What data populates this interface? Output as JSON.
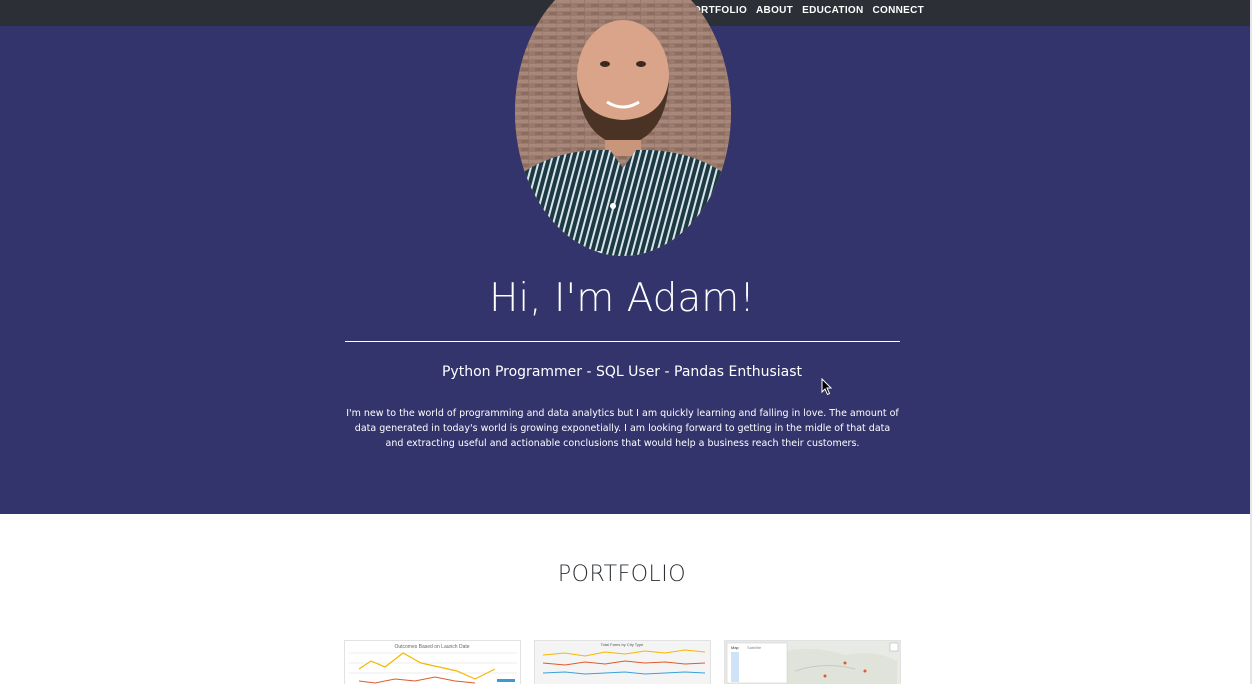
{
  "nav": {
    "items": [
      {
        "label": "PORTFOLIO"
      },
      {
        "label": "ABOUT"
      },
      {
        "label": "EDUCATION"
      },
      {
        "label": "CONNECT"
      }
    ]
  },
  "hero": {
    "title": "Hi, I'm Adam!",
    "subtitle": "Python Programmer - SQL User - Pandas Enthusiast",
    "bio": "I'm new to the world of programming and data analytics but I am quickly learning and falling in love. The amount of data generated in today's world is growing exponetially. I am looking forward to getting in the midle of that data and extracting useful and actionable conclusions that would help a business reach their customers.",
    "avatar_icon": "profile-photo",
    "background_color": "#33346b"
  },
  "portfolio": {
    "title": "PORTFOLIO",
    "thumbnails": [
      {
        "caption": "Outcomes Based on Launch Date"
      },
      {
        "caption": "Total Fares by City Type"
      },
      {
        "caption": "Map",
        "tab2": "Satellite"
      }
    ]
  },
  "colors": {
    "navbar": "#2c3036",
    "hero": "#33346b",
    "text_light": "#ffffff",
    "text_dark": "#2c3036"
  }
}
